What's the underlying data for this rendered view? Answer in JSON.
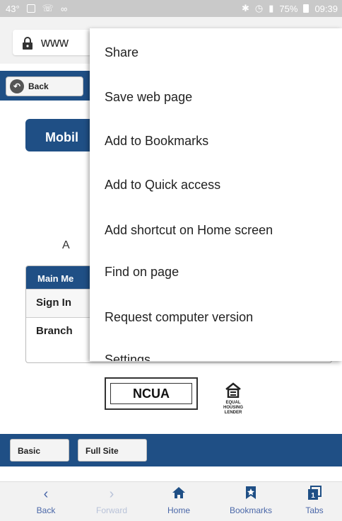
{
  "status_bar": {
    "left_text": "43°",
    "battery": "75%",
    "time": "09:39"
  },
  "browser": {
    "url_text": "www"
  },
  "page": {
    "back_label": "Back",
    "mobile_button_label": "Mobil",
    "partial_text": "A",
    "main_menu": {
      "header": "Main Me",
      "rows": [
        "Sign In",
        "Branch"
      ]
    },
    "ncua_label": "NCUA",
    "equal_housing_label": "EQUAL HOUSING LENDER",
    "footer_buttons": [
      "Basic",
      "Full Site"
    ]
  },
  "context_menu": {
    "items": [
      "Share",
      "Save web page",
      "Add to Bookmarks",
      "Add to Quick access",
      "Add shortcut on Home screen",
      "Find on page",
      "Request computer version",
      "Settings"
    ]
  },
  "toolbar": {
    "items": [
      {
        "label": "Back",
        "icon": "chevron-left-icon"
      },
      {
        "label": "Forward",
        "icon": "chevron-right-icon"
      },
      {
        "label": "Home",
        "icon": "home-icon"
      },
      {
        "label": "Bookmarks",
        "icon": "bookmark-star-icon"
      },
      {
        "label": "Tabs",
        "icon": "tabs-icon"
      }
    ],
    "tabs_count": "1"
  },
  "colors": {
    "brand_blue": "#1f4f85",
    "toolbar_icon": "#4a67a8"
  }
}
